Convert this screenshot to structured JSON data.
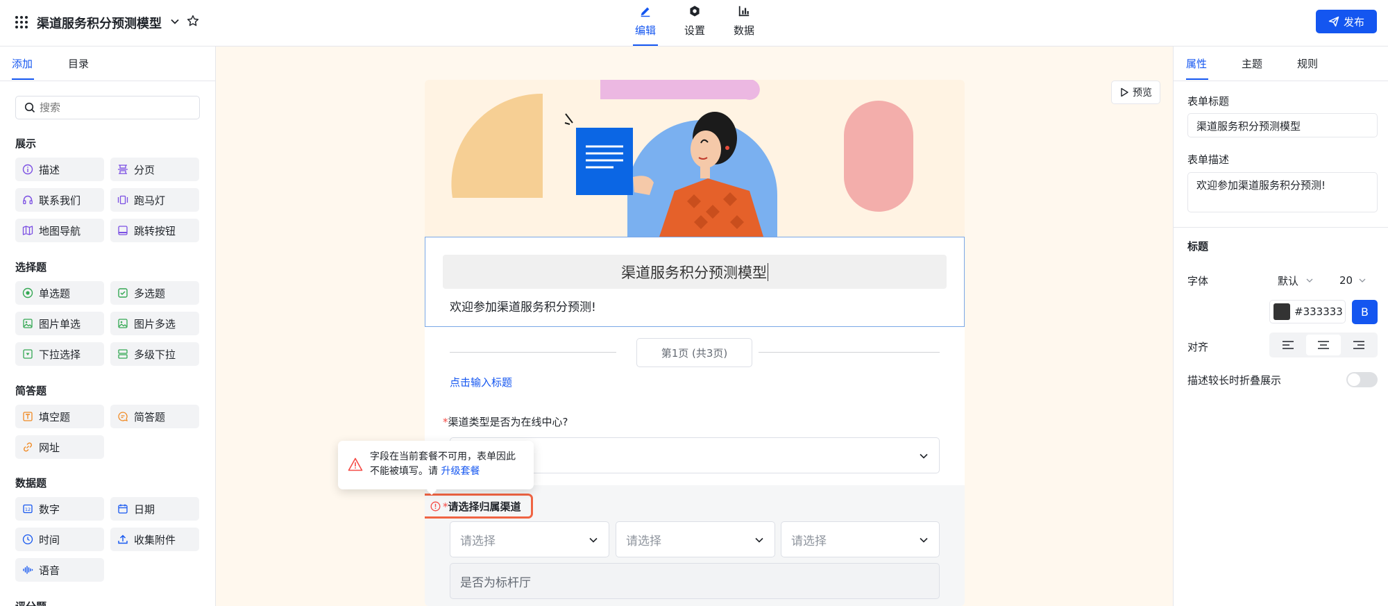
{
  "header": {
    "title": "渠道服务积分预测模型",
    "tabs": [
      {
        "label": "编辑",
        "icon": "pencil-icon",
        "active": true
      },
      {
        "label": "设置",
        "icon": "hexagon-gear-icon",
        "active": false
      },
      {
        "label": "数据",
        "icon": "bar-chart-icon",
        "active": false
      }
    ],
    "publish_label": "发布",
    "accent": "#1456f0"
  },
  "left": {
    "tabs": [
      "添加",
      "目录"
    ],
    "search_placeholder": "搜索",
    "sections": [
      {
        "title": "展示",
        "items": [
          {
            "label": "描述",
            "icon": "info-circle-icon"
          },
          {
            "label": "分页",
            "icon": "page-break-icon"
          },
          {
            "label": "联系我们",
            "icon": "headset-icon"
          },
          {
            "label": "跑马灯",
            "icon": "carousel-icon"
          },
          {
            "label": "地图导航",
            "icon": "map-icon"
          },
          {
            "label": "跳转按钮",
            "icon": "jump-button-icon"
          }
        ]
      },
      {
        "title": "选择题",
        "items": [
          {
            "label": "单选题",
            "icon": "radio-icon"
          },
          {
            "label": "多选题",
            "icon": "checkbox-icon"
          },
          {
            "label": "图片单选",
            "icon": "image-icon"
          },
          {
            "label": "图片多选",
            "icon": "image-icon"
          },
          {
            "label": "下拉选择",
            "icon": "dropdown-icon"
          },
          {
            "label": "多级下拉",
            "icon": "cascade-icon"
          }
        ]
      },
      {
        "title": "简答题",
        "items": [
          {
            "label": "填空题",
            "icon": "text-field-icon"
          },
          {
            "label": "简答题",
            "icon": "comment-icon"
          },
          {
            "label": "网址",
            "icon": "link-icon"
          }
        ]
      },
      {
        "title": "数据题",
        "items": [
          {
            "label": "数字",
            "icon": "number-icon"
          },
          {
            "label": "日期",
            "icon": "calendar-icon"
          },
          {
            "label": "时间",
            "icon": "clock-icon"
          },
          {
            "label": "收集附件",
            "icon": "upload-icon"
          },
          {
            "label": "语音",
            "icon": "voice-icon"
          }
        ]
      },
      {
        "title": "评分题",
        "items": []
      }
    ]
  },
  "canvas": {
    "preview_label": "预览",
    "form_title": "渠道服务积分预测模型",
    "form_desc": "欢迎参加渠道服务积分预测!",
    "page_indicator": "第1页 (共3页)",
    "section_title_placeholder": "点击输入标题",
    "q1_label": "渠道类型是否为在线中心?",
    "q2_label": "请选择归属渠道",
    "required_mark": "*",
    "select_placeholder": "请选择",
    "q3_placeholder": "是否为标杆厅",
    "tooltip_text": "字段在当前套餐不可用，表单因此不能被填写。请",
    "tooltip_link": "升级套餐"
  },
  "right": {
    "tabs": [
      "属性",
      "主题",
      "规则"
    ],
    "form_title_label": "表单标题",
    "form_title_value": "渠道服务积分预测模型",
    "form_desc_label": "表单描述",
    "form_desc_value": "欢迎参加渠道服务积分预测!",
    "heading_section": "标题",
    "font_label": "字体",
    "font_value": "默认",
    "size_value": "20",
    "color_value": "#333333",
    "bold_label": "B",
    "align_label": "对齐",
    "collapse_label": "描述较长时折叠展示"
  }
}
